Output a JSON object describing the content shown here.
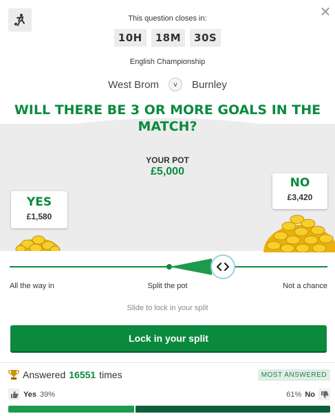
{
  "header": {
    "sport_icon": "football-player-icon",
    "close_icon": "close-icon",
    "closes_label": "This question closes in:",
    "timer": {
      "hours": "10H",
      "minutes": "18M",
      "seconds": "30S"
    },
    "league": "English Championship",
    "home_team": "West Brom",
    "vs": "v",
    "away_team": "Burnley"
  },
  "question": "WILL THERE BE 3 OR MORE GOALS IN THE MATCH?",
  "pot": {
    "label": "YOUR POT",
    "value": "£5,000"
  },
  "yes_card": {
    "label": "YES",
    "amount": "£1,580"
  },
  "no_card": {
    "label": "NO",
    "amount": "£3,420"
  },
  "slider": {
    "left_label": "All the way in",
    "mid_label": "Split the pot",
    "right_label": "Not a chance",
    "hint": "Slide to lock in your split",
    "handle_icon": "chevron-left-right-icon",
    "split_no_fraction": 0.684
  },
  "lock_button": "Lock in your split",
  "stats": {
    "trophy_icon": "trophy-icon",
    "answered_prefix": "Answered",
    "answered_count": "16551",
    "answered_suffix": "times",
    "badge": "MOST ANSWERED",
    "yes_label": "Yes",
    "yes_pct": "39%",
    "no_label": "No",
    "no_pct": "61%",
    "yes_fraction": 0.39
  },
  "colors": {
    "brand_green": "#0b8a3e",
    "dark_green": "#0d5f3c",
    "coin_gold": "#f2c21a"
  }
}
